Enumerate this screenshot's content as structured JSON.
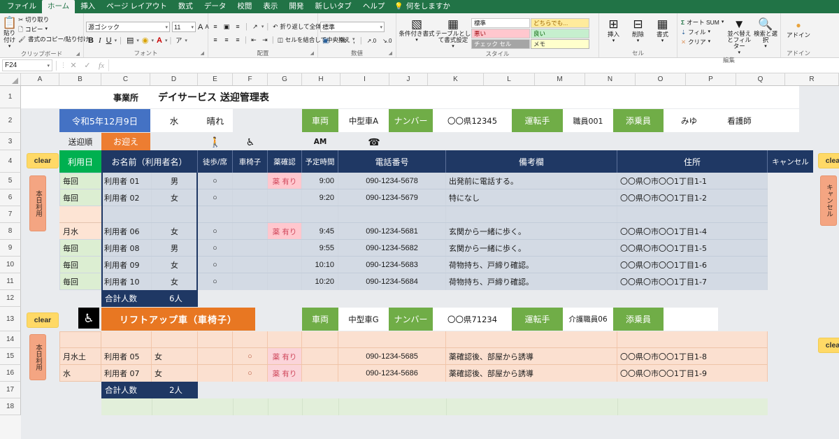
{
  "app": {
    "tabs": [
      "ファイル",
      "ホーム",
      "挿入",
      "ページ レイアウト",
      "数式",
      "データ",
      "校閲",
      "表示",
      "開発",
      "新しいタブ",
      "ヘルプ"
    ],
    "active_tab": "ホーム",
    "tell_me": "何をしますか"
  },
  "ribbon": {
    "clipboard": {
      "paste": "貼り付け",
      "cut": "切り取り",
      "copy": "コピー",
      "format_painter": "書式のコピー/貼り付け",
      "title": "クリップボード"
    },
    "font": {
      "name": "源ゴシック",
      "size": "11",
      "grow": "A",
      "shrink": "A",
      "bold": "B",
      "italic": "I",
      "underline": "U",
      "borders": "田",
      "fill": "A",
      "color": "A",
      "phonetic": "ア",
      "title": "フォント"
    },
    "alignment": {
      "wrap_text": "折り返して全体を表示する",
      "merge_center": "セルを結合して中央揃え",
      "orientation": "abc",
      "title": "配置"
    },
    "number": {
      "format": "標準",
      "accounting": "¥",
      "percent": "%",
      "comma": ",",
      "inc_decimal": ".00",
      "dec_decimal": ".00",
      "title": "数値"
    },
    "styles": {
      "conditional": "条件付き書式",
      "table": "テーブルとして書式設定",
      "normal": "標準",
      "either": "どちらでも...",
      "good": "良い",
      "bad": "悪い",
      "check": "チェック セル",
      "memo": "メモ",
      "title": "スタイル"
    },
    "cells": {
      "insert": "挿入",
      "delete": "削除",
      "format": "書式",
      "title": "セル"
    },
    "editing": {
      "autosum": "オート SUM",
      "fill": "フィル",
      "clear": "クリア",
      "sort_filter": "並べ替えとフィルター",
      "find_select": "検索と選択",
      "title": "編集"
    },
    "addins": {
      "addin": "アドイン",
      "title": "アドイン"
    }
  },
  "formula_bar": {
    "name_box": "F24",
    "cancel": "✕",
    "enter": "✓",
    "fx": "fx",
    "value": ""
  },
  "grid": {
    "columns": [
      "A",
      "B",
      "C",
      "D",
      "E",
      "F",
      "G",
      "H",
      "I",
      "J",
      "K",
      "L",
      "M",
      "N",
      "O",
      "P",
      "Q",
      "R"
    ],
    "rows": [
      "1",
      "2",
      "3",
      "4",
      "5",
      "6",
      "7",
      "8",
      "9",
      "10",
      "11",
      "12",
      "13",
      "14",
      "15",
      "16",
      "17",
      "18"
    ]
  },
  "sheet": {
    "title_label": "事業所",
    "title": "デイサービス 送迎管理表",
    "date": "令和5年12月9日",
    "weekday": "水",
    "weather": "晴れ",
    "order_label": "送迎順",
    "pickup_label": "お迎え",
    "am_label": "AM",
    "walk_icon": "walking-person-icon",
    "wheelchair_icon": "wheelchair-icon",
    "phone_icon": "telephone-icon",
    "vehicle1": {
      "vehicle_label": "車両",
      "vehicle_value": "中型車A",
      "number_label": "ナンバー",
      "number_value": "〇〇県12345",
      "driver_label": "運転手",
      "driver_value": "職員001",
      "attendant_label": "添乗員",
      "attendant_value": "みゆ",
      "nurse_value": "看護師"
    },
    "headers": {
      "clear_left": "clear",
      "use_day": "利用日",
      "name": "お名前（利用者名）",
      "walk_seat": "徒歩/席",
      "wheelchair": "車椅子",
      "medicine": "薬確認",
      "time": "予定時間",
      "phone": "電話番号",
      "remarks": "備考欄",
      "address": "住所",
      "cancel": "キャンセル",
      "clear_right": "clear"
    },
    "side_buttons": {
      "today_use": "本日利用",
      "cancel_vert": "キャンセル"
    },
    "rows1": [
      {
        "row": "5",
        "day": "毎回",
        "name": "利用者 01",
        "sex": "男",
        "walk": "○",
        "wc": "",
        "med": "薬 有り",
        "time": "9:00",
        "phone": "090-1234-5678",
        "remarks": "出発前に電話する。",
        "address": "〇〇県〇市〇〇1丁目1-1",
        "cancel": ""
      },
      {
        "row": "6",
        "day": "毎回",
        "name": "利用者 02",
        "sex": "女",
        "walk": "○",
        "wc": "",
        "med": "",
        "time": "9:20",
        "phone": "090-1234-5679",
        "remarks": "特になし",
        "address": "〇〇県〇市〇〇1丁目1-2",
        "cancel": ""
      },
      {
        "row": "7",
        "day": "",
        "name": "",
        "sex": "",
        "walk": "",
        "wc": "",
        "med": "",
        "time": "",
        "phone": "",
        "remarks": "",
        "address": "",
        "cancel": ""
      },
      {
        "row": "8",
        "day": "月水",
        "name": "利用者 06",
        "sex": "女",
        "walk": "○",
        "wc": "",
        "med": "薬 有り",
        "time": "9:45",
        "phone": "090-1234-5681",
        "remarks": "玄関から一緒に歩く。",
        "address": "〇〇県〇市〇〇1丁目1-4",
        "cancel": ""
      },
      {
        "row": "9",
        "day": "毎回",
        "name": "利用者 08",
        "sex": "男",
        "walk": "○",
        "wc": "",
        "med": "",
        "time": "9:55",
        "phone": "090-1234-5682",
        "remarks": "玄関から一緒に歩く。",
        "address": "〇〇県〇市〇〇1丁目1-5",
        "cancel": ""
      },
      {
        "row": "10",
        "day": "毎回",
        "name": "利用者 09",
        "sex": "女",
        "walk": "○",
        "wc": "",
        "med": "",
        "time": "10:10",
        "phone": "090-1234-5683",
        "remarks": "荷物持ち、戸締り確認。",
        "address": "〇〇県〇市〇〇1丁目1-6",
        "cancel": ""
      },
      {
        "row": "11",
        "day": "毎回",
        "name": "利用者 10",
        "sex": "女",
        "walk": "○",
        "wc": "",
        "med": "",
        "time": "10:20",
        "phone": "090-1234-5684",
        "remarks": "荷物持ち、戸締り確認。",
        "address": "〇〇県〇市〇〇1丁目1-7",
        "cancel": ""
      }
    ],
    "total1_label": "合計人数",
    "total1_value": "6人",
    "section2": {
      "clear": "clear",
      "wheelchair_icon": "wheelchair-icon",
      "title": "リフトアップ車（車椅子）",
      "vehicle_label": "車両",
      "vehicle_value": "中型車G",
      "number_label": "ナンバー",
      "number_value": "〇〇県71234",
      "driver_label": "運転手",
      "driver_value": "介護職員06",
      "attendant_label": "添乗員",
      "attendant_value": "",
      "clear_right": "clear"
    },
    "rows2": [
      {
        "row": "14",
        "day": "",
        "name": "",
        "sex": "",
        "walk": "",
        "wc": "",
        "med": "",
        "time": "",
        "phone": "",
        "remarks": "",
        "address": "",
        "cancel": ""
      },
      {
        "row": "15",
        "day": "月水土",
        "name": "利用者 05",
        "sex": "女",
        "walk": "",
        "wc": "○",
        "med": "薬 有り",
        "time": "",
        "phone": "090-1234-5685",
        "remarks": "薬確認後、部屋から誘導",
        "address": "〇〇県〇市〇〇1丁目1-8",
        "cancel": ""
      },
      {
        "row": "16",
        "day": "水",
        "name": "利用者 07",
        "sex": "女",
        "walk": "",
        "wc": "○",
        "med": "薬 有り",
        "time": "",
        "phone": "090-1234-5686",
        "remarks": "薬確認後、部屋から誘導",
        "address": "〇〇県〇市〇〇1丁目1-9",
        "cancel": ""
      }
    ],
    "total2_label": "合計人数",
    "total2_value": "2人"
  },
  "colors": {
    "brand_green": "#217346",
    "navy": "#1f3864",
    "orange": "#ed7d31",
    "accent_green": "#70ad47",
    "blue": "#4472c4",
    "clear_yellow": "#ffd966",
    "peach": "#f4a582"
  }
}
